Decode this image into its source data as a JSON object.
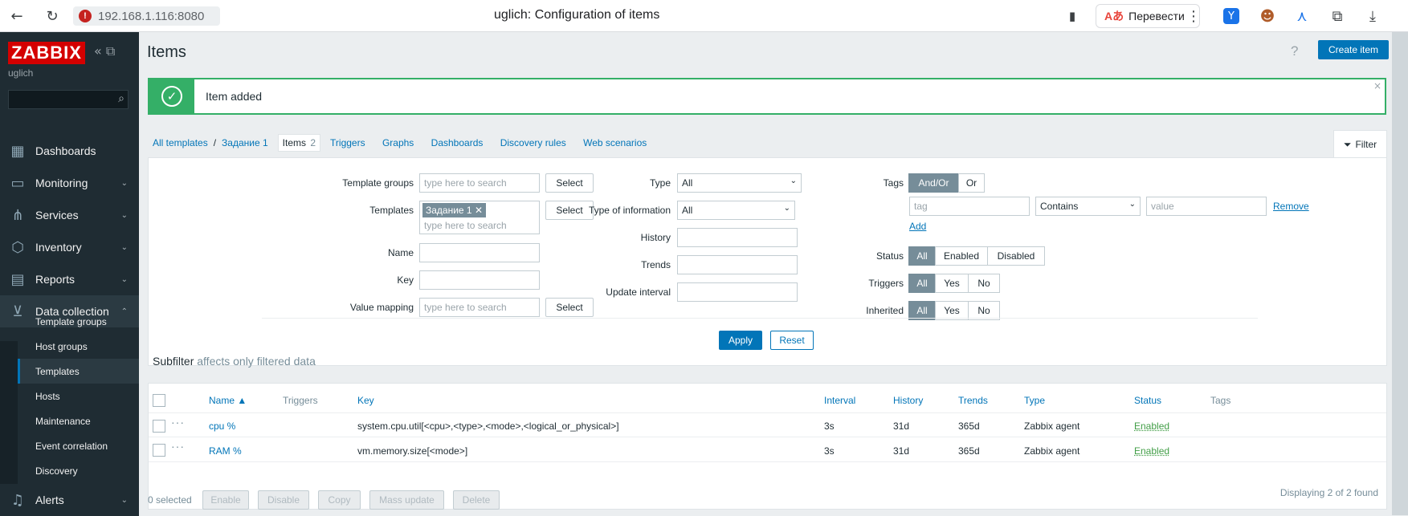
{
  "browser": {
    "url": "192.168.1.116:8080",
    "tab_title": "uglich: Configuration of items",
    "translate_label": "Перевести"
  },
  "sidebar": {
    "logo": "ZABBIX",
    "server_name": "uglich",
    "menu": [
      {
        "label": "Dashboards",
        "icon": "dashboards-icon"
      },
      {
        "label": "Monitoring",
        "icon": "monitoring-icon"
      },
      {
        "label": "Services",
        "icon": "services-icon"
      },
      {
        "label": "Inventory",
        "icon": "inventory-icon"
      },
      {
        "label": "Reports",
        "icon": "reports-icon"
      },
      {
        "label": "Data collection",
        "icon": "data-collection-icon"
      },
      {
        "label": "Alerts",
        "icon": "alerts-icon"
      }
    ],
    "submenu": [
      "Template groups",
      "Host groups",
      "Templates",
      "Hosts",
      "Maintenance",
      "Event correlation",
      "Discovery"
    ],
    "active_submenu": "Templates"
  },
  "header": {
    "title": "Items",
    "help": "?",
    "create_button": "Create item"
  },
  "message": {
    "text": "Item added",
    "close": "×"
  },
  "breadcrumbs": {
    "all_templates": "All templates",
    "sep": "/",
    "template": "Задание 1",
    "current": "Items",
    "current_count": "2",
    "tabs": [
      "Triggers",
      "Graphs",
      "Dashboards",
      "Discovery rules",
      "Web scenarios"
    ]
  },
  "filter": {
    "tab_label": "Filter",
    "template_groups_label": "Template groups",
    "template_groups_placeholder": "type here to search",
    "templates_label": "Templates",
    "templates_chip": "Задание 1",
    "templates_placeholder": "type here to search",
    "select_label": "Select",
    "name_label": "Name",
    "key_label": "Key",
    "value_mapping_label": "Value mapping",
    "value_mapping_placeholder": "type here to search",
    "type_label": "Type",
    "type_value": "All",
    "type_info_label": "Type of information",
    "type_info_value": "All",
    "history_label": "History",
    "trends_label": "Trends",
    "update_interval_label": "Update interval",
    "tags_label": "Tags",
    "tags_andor": "And/Or",
    "tags_or": "Or",
    "tag_placeholder": "tag",
    "tag_operator": "Contains",
    "value_placeholder": "value",
    "remove_label": "Remove",
    "add_label": "Add",
    "status_label": "Status",
    "status_options": [
      "All",
      "Enabled",
      "Disabled"
    ],
    "triggers_label": "Triggers",
    "triggers_options": [
      "All",
      "Yes",
      "No"
    ],
    "inherited_label": "Inherited",
    "inherited_options": [
      "All",
      "Yes",
      "No"
    ],
    "apply": "Apply",
    "reset": "Reset"
  },
  "subfilter": {
    "title": "Subfilter",
    "note": "affects only filtered data"
  },
  "table": {
    "columns": [
      "Name ▲",
      "Triggers",
      "Key",
      "Interval",
      "History",
      "Trends",
      "Type",
      "Status",
      "Tags"
    ],
    "rows": [
      {
        "name": "cpu %",
        "triggers": "",
        "key": "system.cpu.util[<cpu>,<type>,<mode>,<logical_or_physical>]",
        "interval": "3s",
        "history": "31d",
        "trends": "365d",
        "type": "Zabbix agent",
        "status": "Enabled"
      },
      {
        "name": "RAM %",
        "triggers": "",
        "key": "vm.memory.size[<mode>]",
        "interval": "3s",
        "history": "31d",
        "trends": "365d",
        "type": "Zabbix agent",
        "status": "Enabled"
      }
    ],
    "displaying": "Displaying 2 of 2 found"
  },
  "footer": {
    "selected": "0 selected",
    "buttons": [
      "Enable",
      "Disable",
      "Copy",
      "Mass update",
      "Delete"
    ]
  },
  "colors": {
    "accent": "#0275b8",
    "sidebar": "#1f2c33",
    "success": "#34af67",
    "logo": "#d40000"
  }
}
